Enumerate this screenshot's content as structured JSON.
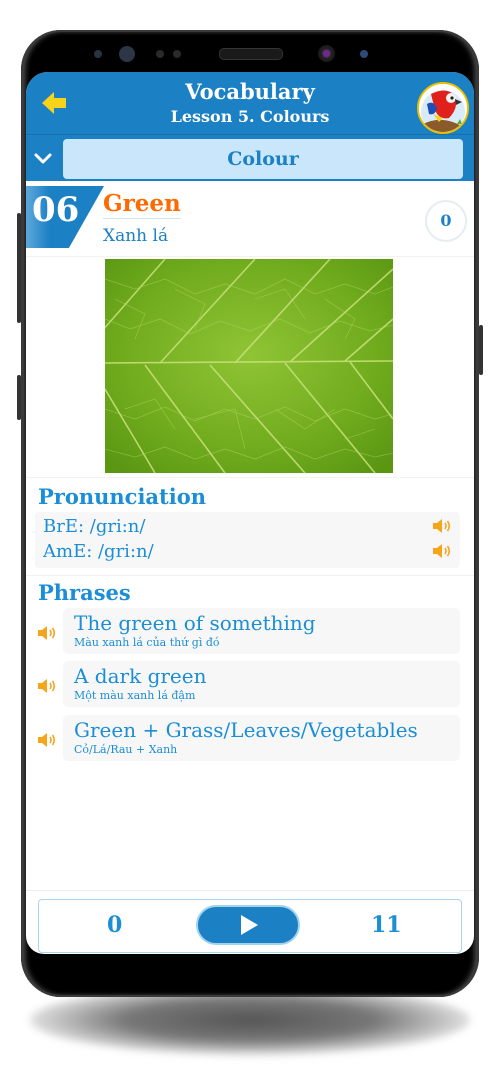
{
  "header": {
    "title": "Vocabulary",
    "subtitle": "Lesson 5. Colours",
    "back_icon": "arrow-left-icon",
    "avatar": "parrot-mascot"
  },
  "category": {
    "selected": "Colour",
    "toggle_icon": "chevron-down-icon"
  },
  "word": {
    "number": "06",
    "english": "Green",
    "vietnamese": "Xanh lá",
    "score": "0",
    "image": "green-leaf-closeup"
  },
  "pronunciation": {
    "title": "Pronunciation",
    "items": [
      {
        "label": "BrE: /gri:n/",
        "icon": "speaker-icon"
      },
      {
        "label": "AmE: /gri:n/",
        "icon": "speaker-icon"
      }
    ]
  },
  "phrases": {
    "title": "Phrases",
    "items": [
      {
        "english": "The green of something",
        "vietnamese": "Màu xanh lá của thứ gì đó"
      },
      {
        "english": "A dark green",
        "vietnamese": "Một màu xanh lá đậm"
      },
      {
        "english": "Green + Grass/Leaves/Vegetables",
        "vietnamese": "Cỏ/Lá/Rau + Xanh"
      }
    ]
  },
  "footer": {
    "left_count": "0",
    "right_count": "11",
    "play_icon": "play-icon"
  },
  "colors": {
    "primary": "#1b80c4",
    "accent_orange": "#ff6a00",
    "speaker_orange": "#f7a41d",
    "category_bg": "#c9e6fb"
  }
}
